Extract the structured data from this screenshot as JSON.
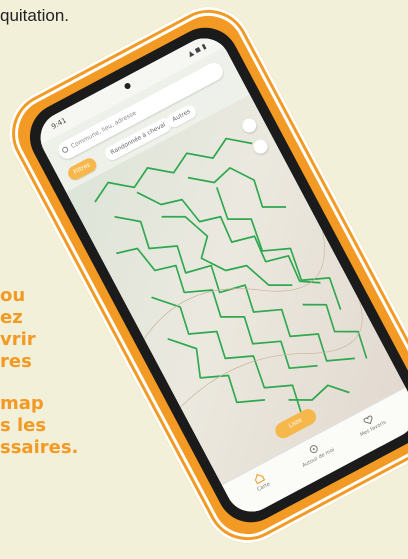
{
  "top_text": "quitation.",
  "promo_lines": [
    "ou",
    "ez",
    "vrir",
    "res",
    "",
    "map",
    "s les",
    "ssaires."
  ],
  "app": {
    "status": {
      "time": "9:41",
      "icons": "▲ ◼ ▮"
    },
    "search_placeholder": "Commune, lieu, adresse",
    "chips": [
      "Filtres",
      "Randonnée à cheval",
      "Autres"
    ],
    "list_button": "Liste",
    "nav": [
      {
        "label": "Carte",
        "icon": "house-icon"
      },
      {
        "label": "Autour de moi",
        "icon": "target-icon"
      },
      {
        "label": "Mes favoris",
        "icon": "heart-icon"
      }
    ]
  },
  "colors": {
    "accent": "#f29a24",
    "trail": "#2fa84f",
    "page_bg": "#f3f0da"
  }
}
